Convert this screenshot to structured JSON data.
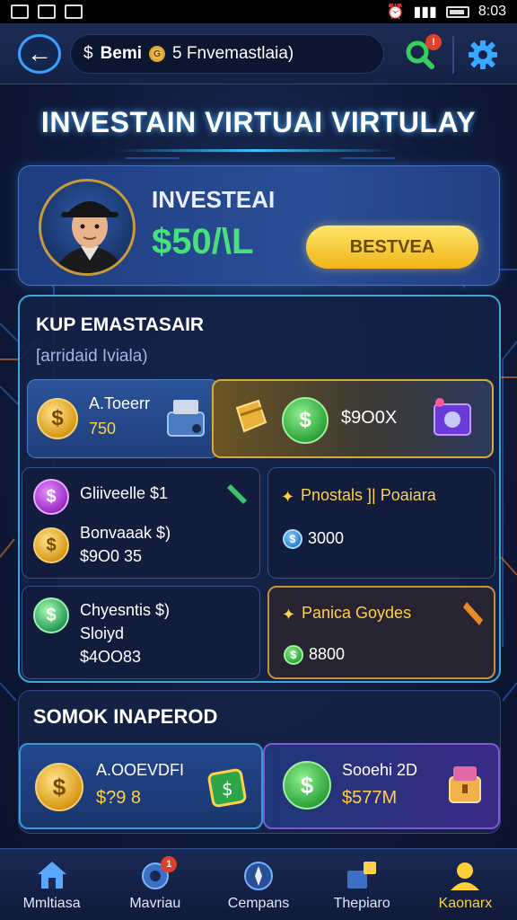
{
  "status_bar": {
    "time": "8:03"
  },
  "header": {
    "balance_prefix": "$",
    "account_name": "Bemi",
    "account_badge": "G",
    "account_detail": "5 Fnvemastlaia)",
    "search_badge": "!",
    "colors": {
      "accent": "#3aa0ff",
      "search": "#35d05a"
    }
  },
  "title": "INVESTAIN VIRTUAI VIRTULAY",
  "profile": {
    "name": "INVESTEAI",
    "balance": "$50/\\L",
    "button_label": "BESTVEA"
  },
  "portfolio": {
    "title": "KUP EMASTASAIR",
    "subtitle": "[arridaid Iviala)",
    "card_a": {
      "label": "A.Toeerr",
      "value": "750"
    },
    "card_b": {
      "value": "$9O0X"
    },
    "items": [
      {
        "title": "Gliiveelle $1",
        "icon": "dollar-coin"
      },
      {
        "title": "Pnostals ]| Poaiara",
        "icon": "star"
      },
      {
        "title": "Bonvaaak $)",
        "value": "$9O0 35",
        "icon": "gold-coin"
      },
      {
        "title": "",
        "value": "3000",
        "icon": "blue-coin"
      },
      {
        "title": "Chyesntis $)",
        "line2": "Sloiyd",
        "value": "$4OO83",
        "icon": "dollar-coin"
      },
      {
        "title": "Panica Goydes",
        "value": "8800",
        "icon": "green-coin"
      }
    ]
  },
  "stock": {
    "title": "SOMOK INAPEROD",
    "card_left": {
      "label": "A.OOEVDFI",
      "value": "$?9 8"
    },
    "card_right": {
      "label": "Sooehi 2D",
      "value": "$577M"
    }
  },
  "nav": [
    {
      "label": "Mmltiasa",
      "icon": "home-icon"
    },
    {
      "label": "Mavriau",
      "icon": "globe-icon",
      "badge": "1"
    },
    {
      "label": "Cempans",
      "icon": "compass-icon"
    },
    {
      "label": "Thepiaro",
      "icon": "chart-icon"
    },
    {
      "label": "Kaonarx",
      "icon": "profile-icon"
    }
  ]
}
